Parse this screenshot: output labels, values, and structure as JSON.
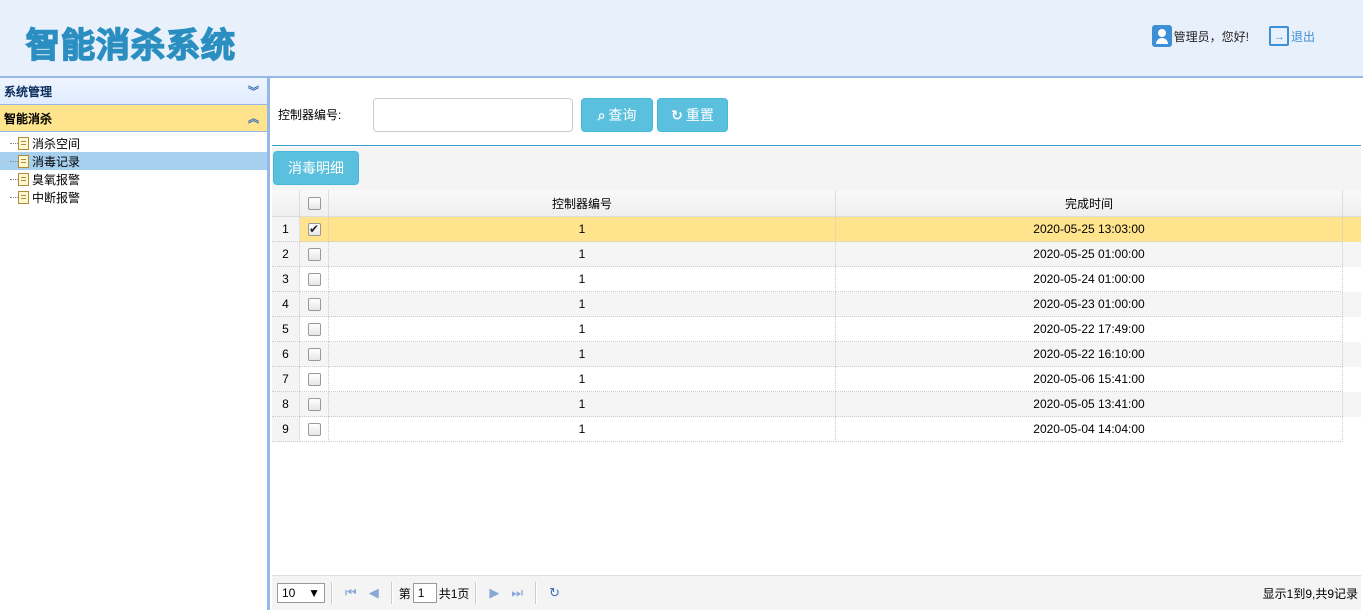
{
  "header": {
    "logo_text": "智能消杀系统",
    "greeting": "管理员，您好!",
    "logout_label": "退出"
  },
  "sidebar": {
    "panels": [
      {
        "label": "系统管理",
        "expanded": false
      },
      {
        "label": "智能消杀",
        "expanded": true
      }
    ],
    "items": [
      {
        "label": "消杀空间"
      },
      {
        "label": "消毒记录"
      },
      {
        "label": "臭氧报警"
      },
      {
        "label": "中断报警"
      }
    ]
  },
  "search": {
    "label": "控制器编号:",
    "input_value": "",
    "query_label": "查询",
    "reset_label": "重置"
  },
  "toolbar": {
    "detail_label": "消毒明细"
  },
  "grid": {
    "columns": [
      "控制器编号",
      "完成时间"
    ],
    "rows": [
      {
        "rn": "1",
        "checked": true,
        "id": "1",
        "time": "2020-05-25 13:03:00"
      },
      {
        "rn": "2",
        "checked": false,
        "id": "1",
        "time": "2020-05-25 01:00:00"
      },
      {
        "rn": "3",
        "checked": false,
        "id": "1",
        "time": "2020-05-24 01:00:00"
      },
      {
        "rn": "4",
        "checked": false,
        "id": "1",
        "time": "2020-05-23 01:00:00"
      },
      {
        "rn": "5",
        "checked": false,
        "id": "1",
        "time": "2020-05-22 17:49:00"
      },
      {
        "rn": "6",
        "checked": false,
        "id": "1",
        "time": "2020-05-22 16:10:00"
      },
      {
        "rn": "7",
        "checked": false,
        "id": "1",
        "time": "2020-05-06 15:41:00"
      },
      {
        "rn": "8",
        "checked": false,
        "id": "1",
        "time": "2020-05-05 13:41:00"
      },
      {
        "rn": "9",
        "checked": false,
        "id": "1",
        "time": "2020-05-04 14:04:00"
      }
    ]
  },
  "pager": {
    "page_size": "10",
    "page_prefix": "第",
    "page_value": "1",
    "page_total": "共1页",
    "info": "显示1到9,共9记录"
  },
  "colors": {
    "accent": "#5bc0de",
    "selected_row": "#ffe48d",
    "selected_tree": "#a6d0ee",
    "border": "#95b8e7"
  }
}
